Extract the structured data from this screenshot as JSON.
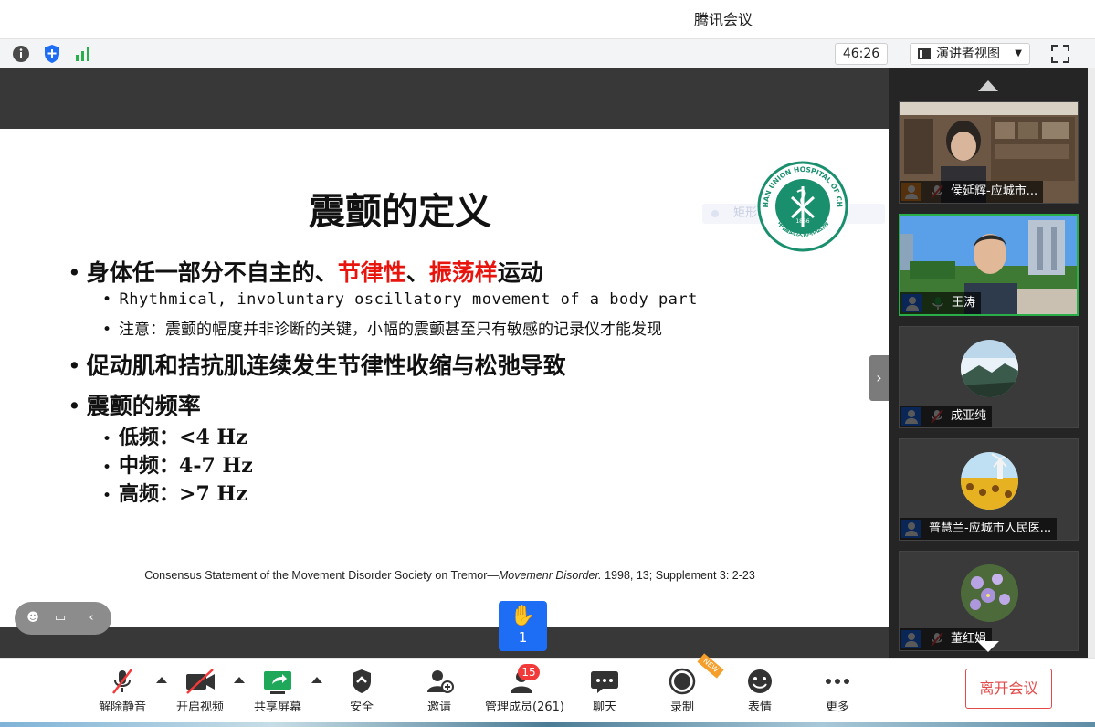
{
  "window": {
    "title": "腾讯会议"
  },
  "topbar": {
    "timer": "46:26",
    "view_mode": "演讲者视图",
    "icons": [
      "info-icon",
      "shield-icon",
      "signal-icon",
      "fullscreen-icon"
    ]
  },
  "slide": {
    "title": "震颤的定义",
    "watermark": "矩形",
    "logo_text": "WUHAN UNION HOSPITAL OF CHINA",
    "logo_year": "1866",
    "logo_cn": "中国武汉协和医院",
    "bullet1": {
      "prefix": "身体任一部分不自主的、",
      "red1": "节律性",
      "sep": "、",
      "red2": "振荡样",
      "suffix": "运动"
    },
    "sub1": "Rhythmical, involuntary oscillatory movement of a body part",
    "sub2": "注意：震颤的幅度并非诊断的关键，小幅的震颤甚至只有敏感的记录仪才能发现",
    "bullet2": "促动肌和拮抗肌连续发生节律性收缩与松弛导致",
    "bullet3": "震颤的频率",
    "freq": [
      "低频：<4 Hz",
      "中频：4-7 Hz",
      "高频：>7 Hz"
    ],
    "citation_pre": "Consensus Statement of the Movement Disorder Society on Tremor—",
    "citation_journal": "Movemenr Disorder.",
    "citation_post": " 1998, 13; Supplement 3: 2-23"
  },
  "hand_raise": {
    "count": "1"
  },
  "participants": [
    {
      "name": "侯延辉-应城市...",
      "muted": true
    },
    {
      "name": "王涛",
      "muted": false
    },
    {
      "name": "成亚纯",
      "muted": true
    },
    {
      "name": "普慧兰-应城市人民医...",
      "muted": false
    },
    {
      "name": "董红娟",
      "muted": true
    }
  ],
  "toolbar": {
    "mute": "解除静音",
    "video": "开启视频",
    "share": "共享屏幕",
    "security": "安全",
    "invite": "邀请",
    "members": "管理成员(261)",
    "members_badge": "15",
    "chat": "聊天",
    "record": "录制",
    "record_tag": "NEW",
    "emoji": "表情",
    "more": "更多",
    "leave": "离开会议"
  },
  "colors": {
    "accent": "#1e6df5",
    "danger": "#e24a4a",
    "highlight": "#e8150f",
    "active_border": "#2aae4a",
    "logo_green": "#1a8f6e"
  }
}
